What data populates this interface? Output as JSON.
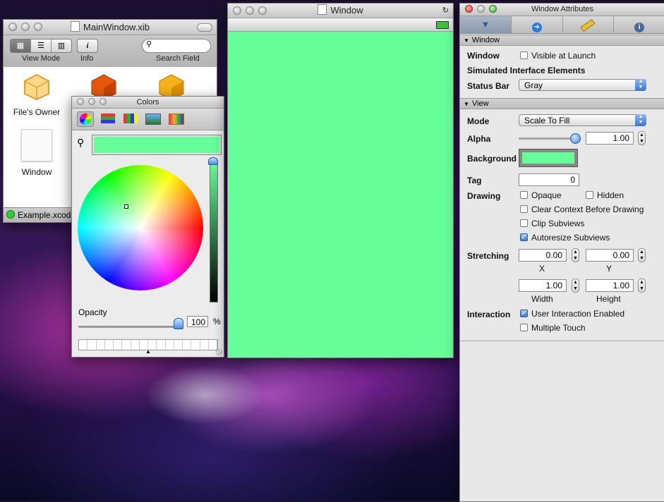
{
  "xib_window": {
    "title": "MainWindow.xib",
    "toolbar": {
      "view_mode_label": "View Mode",
      "info_label": "Info",
      "search_label": "Search Field",
      "info_glyph": "i"
    },
    "objects": [
      {
        "label": "File's Owner"
      },
      {
        "label": "Window"
      }
    ],
    "status": "Example.xcode"
  },
  "colors_panel": {
    "title": "Colors",
    "selected_color": "#66ff99",
    "opacity_label": "Opacity",
    "opacity_value": "100",
    "percent_sign": "%"
  },
  "preview_window": {
    "title": "Window",
    "background_color": "#66ff99"
  },
  "inspector": {
    "title": "Window Attributes",
    "tabs": [
      "attributes-icon",
      "connections-icon",
      "size-icon",
      "identity-icon"
    ],
    "window_section": {
      "header": "Window",
      "window_label": "Window",
      "visible_at_launch": "Visible at Launch",
      "simulated_label": "Simulated Interface Elements",
      "status_bar_label": "Status Bar",
      "status_bar_value": "Gray"
    },
    "view_section": {
      "header": "View",
      "mode_label": "Mode",
      "mode_value": "Scale To Fill",
      "alpha_label": "Alpha",
      "alpha_value": "1.00",
      "background_label": "Background",
      "background_color": "#66ff99",
      "tag_label": "Tag",
      "tag_value": "0",
      "drawing_label": "Drawing",
      "opaque": "Opaque",
      "hidden": "Hidden",
      "clear_context": "Clear Context Before Drawing",
      "clip_subviews": "Clip Subviews",
      "autoresize": "Autoresize Subviews",
      "stretching_label": "Stretching",
      "x_value": "0.00",
      "y_value": "0.00",
      "x_label": "X",
      "y_label": "Y",
      "width_value": "1.00",
      "height_value": "1.00",
      "width_label": "Width",
      "height_label": "Height",
      "interaction_label": "Interaction",
      "user_interaction": "User Interaction Enabled",
      "multiple_touch": "Multiple Touch"
    }
  }
}
